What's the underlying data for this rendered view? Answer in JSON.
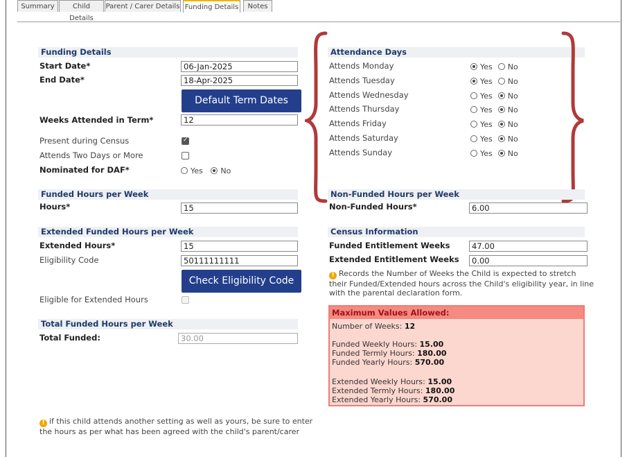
{
  "tabs": [
    "Summary",
    "Child Details",
    "Parent / Carer Details",
    "Funding Details",
    "Notes"
  ],
  "funding_details": {
    "header": "Funding Details",
    "start_date_label": "Start Date*",
    "start_date_value": "06-Jan-2025",
    "end_date_label": "End Date*",
    "end_date_value": "18-Apr-2025",
    "default_term_dates_button": "Default Term Dates",
    "weeks_attended_label": "Weeks Attended in Term*",
    "weeks_attended_value": "12",
    "present_census_label": "Present during Census",
    "present_census_checked": true,
    "two_days_label": "Attends Two Days or More",
    "two_days_checked": false,
    "daf_label": "Nominated for DAF*",
    "daf_value": "No"
  },
  "funded_hours": {
    "header": "Funded Hours per Week",
    "hours_label": "Hours*",
    "hours_value": "15"
  },
  "extended_hours": {
    "header": "Extended Funded Hours per Week",
    "extended_label": "Extended Hours*",
    "extended_value": "15",
    "eligibility_code_label": "Eligibility Code",
    "eligibility_code_value": "50111111111",
    "check_eligibility_button": "Check Eligibility Code",
    "eligible_label": "Eligible for Extended Hours",
    "eligible_checked": false
  },
  "total_funded": {
    "header": "Total Funded Hours per Week",
    "total_label": "Total Funded:",
    "total_value": "30.00"
  },
  "attendance": {
    "header": "Attendance Days",
    "days": [
      {
        "label": "Attends Monday",
        "value": "Yes"
      },
      {
        "label": "Attends Tuesday",
        "value": "Yes"
      },
      {
        "label": "Attends Wednesday",
        "value": "No"
      },
      {
        "label": "Attends Thursday",
        "value": "No"
      },
      {
        "label": "Attends Friday",
        "value": "No"
      },
      {
        "label": "Attends Saturday",
        "value": "No"
      },
      {
        "label": "Attends Sunday",
        "value": "No"
      }
    ],
    "yes_label": "Yes",
    "no_label": "No"
  },
  "non_funded": {
    "header": "Non-Funded Hours per Week",
    "label": "Non-Funded Hours*",
    "value": "6.00"
  },
  "census": {
    "header": "Census Information",
    "funded_weeks_label": "Funded Entitlement Weeks",
    "funded_weeks_value": "47.00",
    "extended_weeks_label": "Extended Entitlement Weeks",
    "extended_weeks_value": "0.00",
    "info_note": "Records the Number of Weeks the Child is expected to stretch their Funded/Extended hours across the Child's eligibility year, in line with the parental declaration form."
  },
  "max_values": {
    "header": "Maximum Values Allowed:",
    "number_of_weeks_label": "Number of Weeks:",
    "number_of_weeks_value": "12",
    "funded_weekly_label": "Funded Weekly Hours:",
    "funded_weekly_value": "15.00",
    "funded_termly_label": "Funded Termly Hours:",
    "funded_termly_value": "180.00",
    "funded_yearly_label": "Funded Yearly Hours:",
    "funded_yearly_value": "570.00",
    "extended_weekly_label": "Extended Weekly Hours:",
    "extended_weekly_value": "15.00",
    "extended_termly_label": "Extended Termly Hours:",
    "extended_termly_value": "180.00",
    "extended_yearly_label": "Extended Yearly Hours:",
    "extended_yearly_value": "570.00"
  },
  "footer_note": "if this child attends another setting as well as yours, be sure to enter the hours as per what has been agreed with the child's parent/carer",
  "colors": {
    "button_blue": "#233f8c",
    "section_header_text": "#1f3a6a",
    "brace_red": "#b03a3a",
    "max_box_bg": "#fcd7cf",
    "max_box_border": "#f07c74",
    "info_icon": "#f0a500"
  }
}
